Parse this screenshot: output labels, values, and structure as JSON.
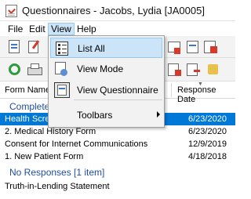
{
  "window": {
    "title": "Questionnaires - Jacobs, Lydia [JA0005]"
  },
  "menubar": {
    "items": [
      {
        "label": "File"
      },
      {
        "label": "Edit"
      },
      {
        "label": "View"
      },
      {
        "label": "Help"
      }
    ]
  },
  "view_menu": {
    "items": [
      {
        "label": "List All",
        "icon": "list-icon",
        "highlighted": true
      },
      {
        "label": "View Mode",
        "icon": "view-mode-icon"
      },
      {
        "label": "View Questionnaire",
        "icon": "questionnaire-icon"
      },
      {
        "label": "Toolbars",
        "icon": "none",
        "submenu": true
      }
    ]
  },
  "columns": {
    "form_name": "Form Name",
    "response_date": "Response Date"
  },
  "groups": [
    {
      "header": "Completed",
      "rows": [
        {
          "name": "Health Scree",
          "date": "6/23/2020",
          "selected": true
        },
        {
          "name": "2. Medical History Form",
          "date": "6/23/2020"
        },
        {
          "name": "Consent for Internet Communications",
          "date": "12/9/2019"
        },
        {
          "name": "1. New Patient Form",
          "date": "4/18/2018"
        }
      ]
    },
    {
      "header": "No Responses [1 item]",
      "rows": [
        {
          "name": "Truth-in-Lending Statement",
          "date": ""
        }
      ]
    }
  ],
  "colors": {
    "selection": "#0078d7",
    "menu_highlight": "#cce4f7",
    "group_header": "#1f4e9e"
  }
}
